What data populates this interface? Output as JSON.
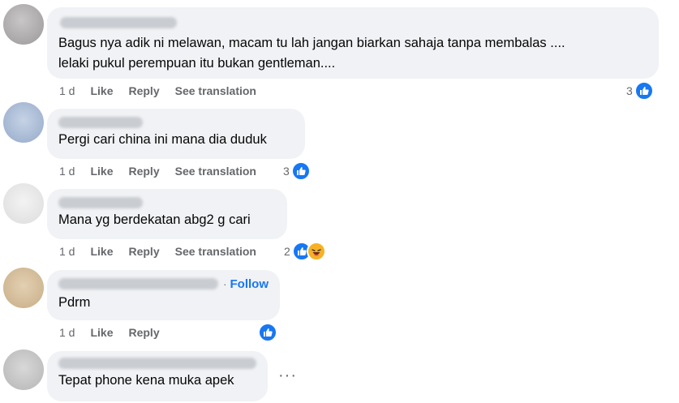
{
  "comments": [
    {
      "text_line1": "Bagus nya adik ni melawan, macam tu lah jangan biarkan sahaja tanpa membalas ....",
      "text_line2": "lelaki pukul perempuan itu bukan gentleman....",
      "time": "1 d",
      "like": "Like",
      "reply": "Reply",
      "translate": "See translation",
      "reaction_count": "3"
    },
    {
      "text": "Pergi cari china ini mana dia duduk",
      "time": "1 d",
      "like": "Like",
      "reply": "Reply",
      "translate": "See translation",
      "reaction_count": "3"
    },
    {
      "text": "Mana yg berdekatan abg2 g cari",
      "time": "1 d",
      "like": "Like",
      "reply": "Reply",
      "translate": "See translation",
      "reaction_count": "2"
    },
    {
      "text": "Pdrm",
      "follow": "Follow",
      "time": "1 d",
      "like": "Like",
      "reply": "Reply"
    },
    {
      "text": "Tepat phone kena muka apek",
      "more": "···"
    }
  ],
  "colors": {
    "accent": "#1877f2",
    "bubble": "#f0f2f5",
    "meta": "#65676b",
    "haha": "#f7b125"
  }
}
